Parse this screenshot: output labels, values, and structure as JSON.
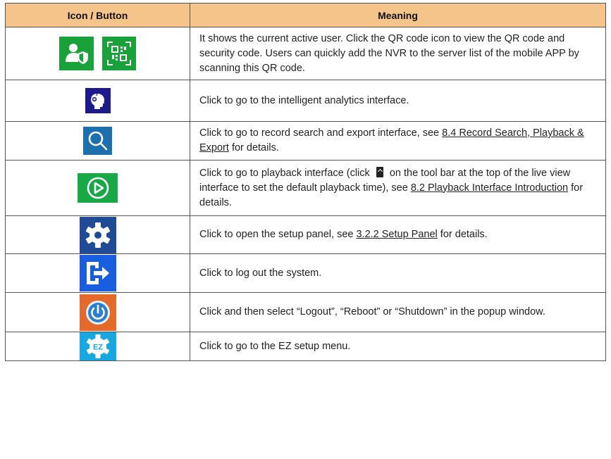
{
  "header": {
    "col1": "Icon / Button",
    "col2": "Meaning"
  },
  "rows": [
    {
      "icons": [
        "user-shield-icon",
        "qr-code-icon"
      ],
      "text": "It shows the current active user. Click the QR code icon to view the QR code and security code. Users can quickly add the NVR to the server list of the mobile APP by scanning this QR code."
    },
    {
      "icons": [
        "intelligent-analytics-icon"
      ],
      "text": "Click to go to the intelligent analytics interface."
    },
    {
      "icons": [
        "search-icon"
      ],
      "text_before": "Click to go to record search and export interface, see ",
      "link": "8.4 Record Search, Playback & Export",
      "text_after": " for details."
    },
    {
      "icons": [
        "play-icon"
      ],
      "text_before": "Click to go to playback interface (click ",
      "inline_icon": "chevron-up-icon",
      "text_mid": " on the tool bar at the top of the live view interface to set the default playback time), see ",
      "link": "8.2 Playback Interface Introduction",
      "text_after": " for details."
    },
    {
      "icons": [
        "gear-icon"
      ],
      "text_before": "Click to open the setup panel, see ",
      "link": "3.2.2 Setup Panel",
      "text_after": " for details."
    },
    {
      "icons": [
        "logout-icon"
      ],
      "text": "Click to log out the system."
    },
    {
      "icons": [
        "power-icon"
      ],
      "text": "Click and then select “Logout”, “Reboot” or “Shutdown” in the popup window."
    },
    {
      "icons": [
        "ez-setup-icon"
      ],
      "icon_text": "EZ",
      "text": "Click to go to the EZ setup menu."
    }
  ],
  "colors": {
    "header_bg": "#f5c48a",
    "green": "#1aa23a",
    "purple": "#1c1a8c",
    "search_blue": "#1d6fae",
    "play_green": "#18a848",
    "gear_blue": "#1f4a95",
    "logout_blue": "#1a5ee0",
    "power_orange": "#e36a2a",
    "ez_cyan": "#18a8e0"
  }
}
